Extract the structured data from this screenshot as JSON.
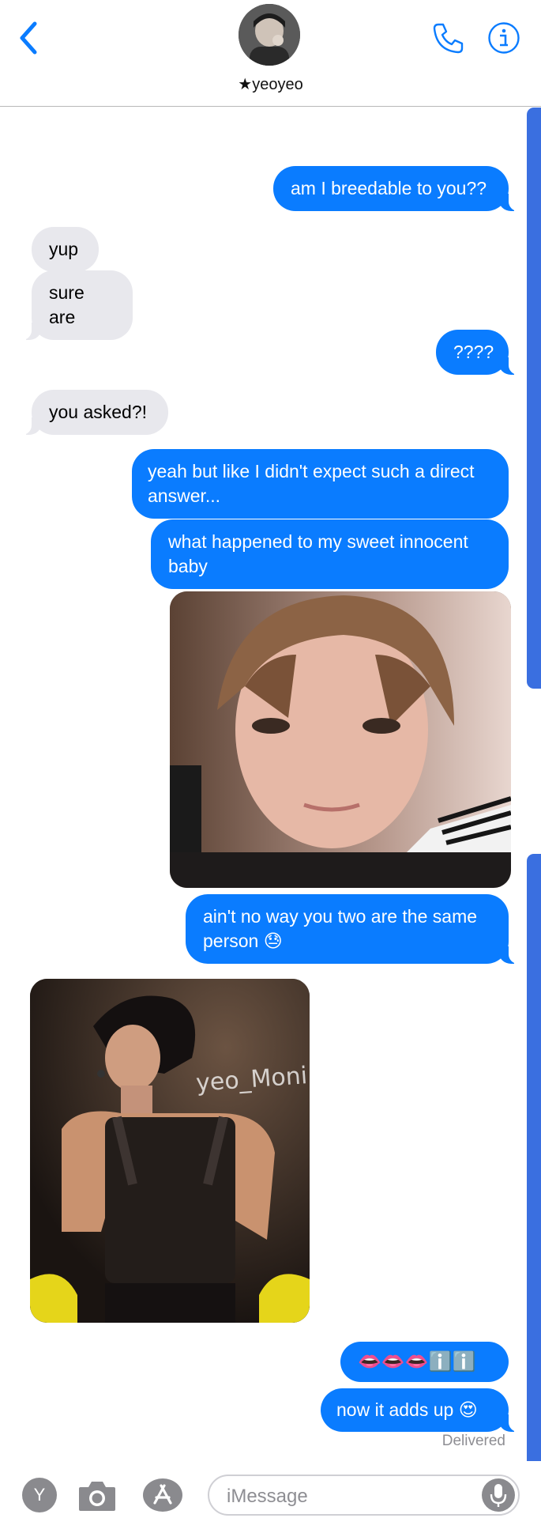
{
  "header": {
    "contact_name": "★yeoyeo"
  },
  "messages": [
    {
      "id": "m1",
      "direction": "outgoing",
      "text": "am I breedable to you??"
    },
    {
      "id": "m2",
      "direction": "incoming",
      "text": "yup"
    },
    {
      "id": "m3",
      "direction": "incoming",
      "text": "sure are"
    },
    {
      "id": "m4",
      "direction": "outgoing",
      "text": "????"
    },
    {
      "id": "m5",
      "direction": "incoming",
      "text": "you asked?!"
    },
    {
      "id": "m6",
      "direction": "outgoing",
      "text": "yeah but like I didn't expect such a direct answer..."
    },
    {
      "id": "m7",
      "direction": "outgoing",
      "text": "what happened to my sweet innocent baby"
    },
    {
      "id": "m8",
      "direction": "outgoing",
      "type": "photo",
      "description": "selfie photo"
    },
    {
      "id": "m9",
      "direction": "outgoing",
      "text": "ain't no way you two are the same person 😓"
    },
    {
      "id": "m10",
      "direction": "incoming",
      "type": "photo",
      "watermark": "yeo_Moni"
    },
    {
      "id": "m11",
      "direction": "outgoing",
      "text": "👄👄👄ℹ️ℹ️"
    },
    {
      "id": "m12",
      "direction": "outgoing",
      "text": "now it adds up 😍"
    }
  ],
  "status": {
    "delivered": "Delivered"
  },
  "composer": {
    "placeholder": "iMessage"
  },
  "colors": {
    "outgoing": "#0a7cff",
    "incoming": "#e8e8ed",
    "accent": "#0a7cff"
  },
  "icons": [
    "back-chevron-icon",
    "phone-icon",
    "info-icon",
    "camera-icon",
    "app-store-icon",
    "mic-icon",
    "memoji-icon"
  ]
}
